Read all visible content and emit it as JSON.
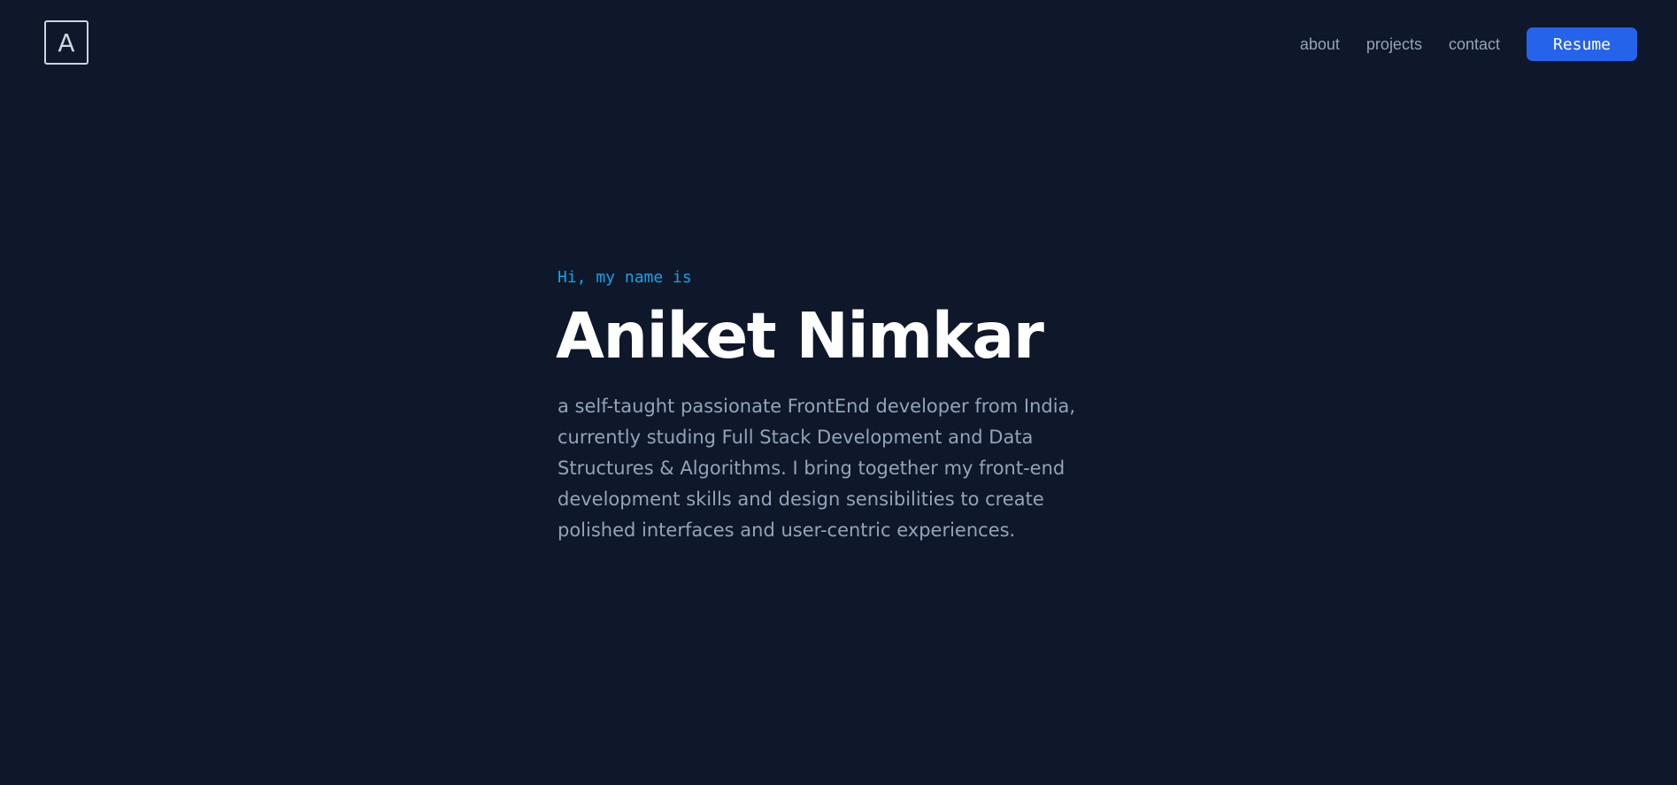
{
  "header": {
    "logo_letter": "A",
    "nav": [
      {
        "label": "about"
      },
      {
        "label": "projects"
      },
      {
        "label": "contact"
      }
    ],
    "resume_label": "Resume"
  },
  "hero": {
    "greeting": "Hi, my name is",
    "name": "Aniket Nimkar",
    "bio": "a self-taught passionate FrontEnd developer from India, currently studing Full Stack Development and Data Structures & Algorithms. I bring together my front-end development skills and design sensibilities to create polished interfaces and user-centric experiences."
  },
  "colors": {
    "background": "#0f172a",
    "accent": "#0ea5e9",
    "button": "#2563eb",
    "muted_text": "#94a3b8",
    "heading": "#ffffff"
  }
}
